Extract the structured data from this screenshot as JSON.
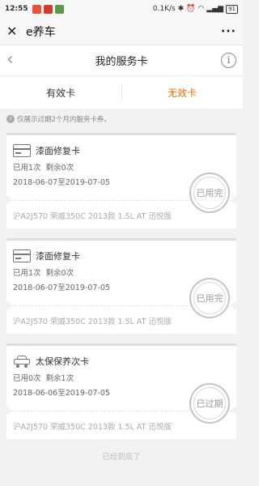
{
  "status_bar": {
    "time": "12:55",
    "speed": "0.1K/s",
    "battery": "91",
    "notification_colors": [
      "#e8503a",
      "#d43b30",
      "#5a9b4a"
    ]
  },
  "wechat_header": {
    "close_icon": "close-icon",
    "title": "e养车",
    "more_icon": "more-icon"
  },
  "page_header": {
    "back_icon": "chevron-left-icon",
    "title": "我的服务卡",
    "info_icon": "info-icon",
    "info_glyph": "i"
  },
  "tabs": [
    {
      "label": "有效卡",
      "active": false
    },
    {
      "label": "无效卡",
      "active": true
    }
  ],
  "accent_color": "#ff6a00",
  "notice": {
    "text": "仅展示过期2个月内服务卡券。"
  },
  "cards": [
    {
      "icon": "card-icon",
      "name": "漆面修复卡",
      "used": "已用1次",
      "remaining": "剩余0次",
      "validity": "2018-06-07至2019-07-05",
      "car": "沪A2J570 荣威350C 2013款 1.5L AT 迅悦版",
      "stamp": "已用完"
    },
    {
      "icon": "card-icon",
      "name": "漆面修复卡",
      "used": "已用1次",
      "remaining": "剩余0次",
      "validity": "2018-06-07至2019-07-05",
      "car": "沪A2J570 荣威350C 2013款 1.5L AT 迅悦版",
      "stamp": "已用完"
    },
    {
      "icon": "car-icon",
      "name": "太保保养次卡",
      "used": "已用0次",
      "remaining": "剩余1次",
      "validity": "2018-06-06至2019-07-05",
      "car": "沪A2J570 荣威350C 2013款 1.5L AT 迅悦版",
      "stamp": "已过期"
    }
  ],
  "end_text": "已经到底了"
}
